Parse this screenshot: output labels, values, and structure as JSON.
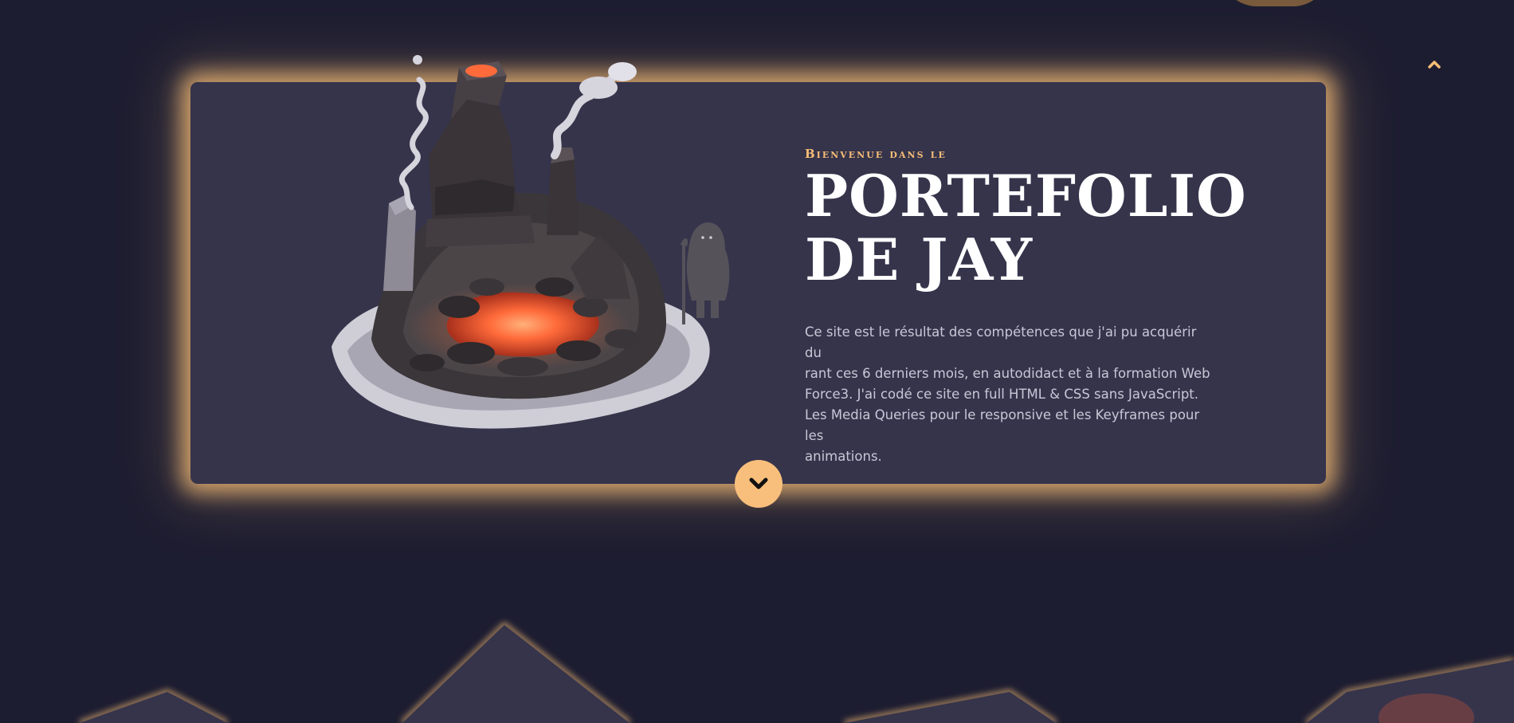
{
  "hero": {
    "kicker": "Bienvenue dans le",
    "title_line1": "Portefolio",
    "title_line2": "de Jay",
    "description_lines": [
      "Ce site est le résultat des compétences que j'ai pu acquérir du",
      "rant ces 6 derniers mois, en autodidact et à la formation Web",
      "Force3. J'ai codé ce site en full HTML & CSS sans JavaScript.",
      "Les Media Queries pour le responsive et les Keyframes pour les",
      "animations."
    ]
  },
  "icons": {
    "scroll_top": "chevron-up-icon",
    "scroll_down": "chevron-down-icon",
    "illustration": "volcano-illustration"
  },
  "colors": {
    "background": "#1d1d31",
    "card": "#36344b",
    "accent": "#f6bd76",
    "title": "#ffffff",
    "body_text": "#c9c7d6",
    "lava": "#ff6a3a"
  }
}
